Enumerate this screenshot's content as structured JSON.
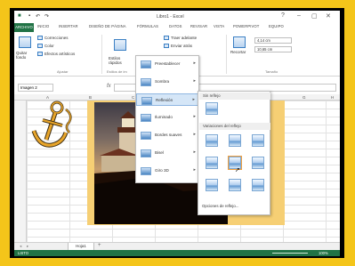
{
  "titlebar": {
    "title": "Libro1 - Excel",
    "help": "?",
    "min": "–",
    "max": "▢",
    "close": "✕"
  },
  "tabs": [
    "ARCHIVO",
    "INICIO",
    "INSERTAR",
    "DISEÑO DE PÁGINA",
    "FÓRMULAS",
    "DATOS",
    "REVISAR",
    "VISTA",
    "POWERPIVOT",
    "EQUIPO"
  ],
  "ribbon": {
    "quitar_fondo": "Quitar fondo",
    "correcciones": "Correcciones",
    "color": "Color",
    "efectos": "Efectos artísticos",
    "ajustar_group": "Ajustar",
    "estilos_rapidos": "Estilos rápidos",
    "estilos_group": "Estilos de im",
    "traer": "Traer adelante",
    "enviar": "Enviar atrás",
    "recortar": "Recortar",
    "alto": "4,14 cm",
    "ancho": "10,65 cm",
    "tamano_group": "Tamaño"
  },
  "formula": {
    "namebox": "Imagen 2",
    "fx": "fx"
  },
  "columns": [
    "A",
    "B",
    "C",
    "D",
    "E",
    "F",
    "G",
    "H"
  ],
  "menu": {
    "items": [
      {
        "label": "Preestablecer"
      },
      {
        "label": "Sombra"
      },
      {
        "label": "Reflexión"
      },
      {
        "label": "Iluminado"
      },
      {
        "label": "Bordes suaves"
      },
      {
        "label": "Bisel"
      },
      {
        "label": "Giro 3D"
      }
    ]
  },
  "submenu": {
    "header1": "Sin reflejo",
    "header2": "Variaciones del reflejo",
    "options": "Opciones de reflejo..."
  },
  "sheet": {
    "name": "Hoja1",
    "add": "+"
  },
  "status": {
    "left": "LISTO",
    "zoom": "100%"
  }
}
